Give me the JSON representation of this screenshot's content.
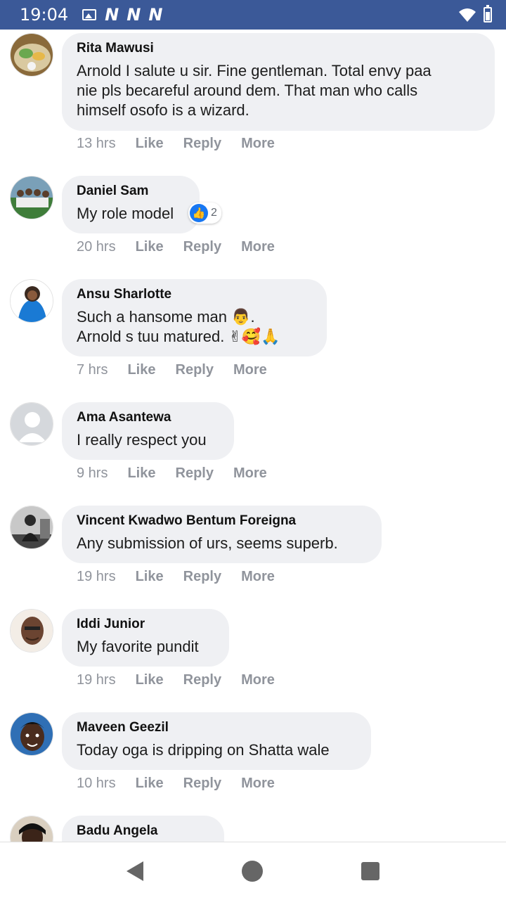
{
  "status": {
    "time": "19:04",
    "notif_letters": [
      "N",
      "N",
      "N"
    ]
  },
  "action_labels": {
    "like": "Like",
    "reply": "Reply",
    "more": "More"
  },
  "comments": [
    {
      "author": "Rita Mawusi",
      "text": "Arnold I salute u sir. Fine gentleman. Total envy paa\nnie pls becareful around dem. That man who calls\nhimself osofo is a wizard.",
      "time": "13 hrs"
    },
    {
      "author": "Daniel Sam",
      "text": "My role model",
      "time": "20 hrs",
      "reaction_count": "2"
    },
    {
      "author": "Ansu Sharlotte",
      "text": "Such a hansome man 👨.\nArnold s tuu matured. ✌🥰🙏",
      "time": "7 hrs"
    },
    {
      "author": "Ama Asantewa",
      "text": "I really respect you",
      "time": "9 hrs"
    },
    {
      "author": "Vincent Kwadwo Bentum Foreigna",
      "text": "Any submission of urs, seems superb.",
      "time": "19 hrs"
    },
    {
      "author": "Iddi Junior",
      "text": "My favorite pundit",
      "time": "19 hrs"
    },
    {
      "author": "Maveen Geezil",
      "text": "Today oga is dripping on Shatta wale",
      "time": "10 hrs"
    },
    {
      "author": "Badu Angela"
    }
  ],
  "icons": {
    "image": "image-icon",
    "wifi": "wifi-icon",
    "battery": "battery-icon",
    "back": "back-icon",
    "home": "home-icon",
    "recents": "recents-icon",
    "like": "like-icon"
  },
  "colors": {
    "status_bar": "#3b5998",
    "bubble": "#eff0f3",
    "meta": "#90949c",
    "like_blue": "#1877f2"
  }
}
